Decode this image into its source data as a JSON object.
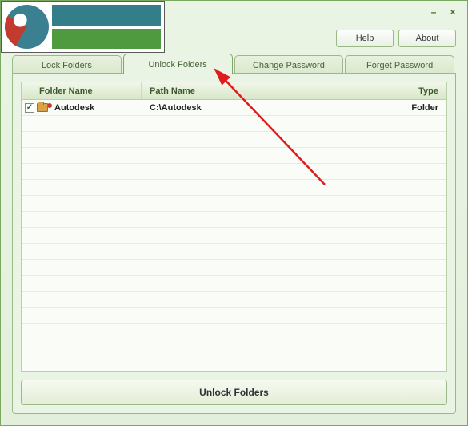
{
  "window": {
    "minimize": "–",
    "close": "×"
  },
  "toolbar": {
    "help": "Help",
    "about": "About"
  },
  "tabs": {
    "lock": "Lock Folders",
    "unlock": "Unlock Folders",
    "change_pw": "Change Password",
    "forget_pw": "Forget Password",
    "active": "unlock"
  },
  "grid": {
    "headers": {
      "name": "Folder Name",
      "path": "Path Name",
      "type": "Type"
    },
    "rows": [
      {
        "checked": true,
        "name": "Autodesk",
        "path": "C:\\Autodesk",
        "type": "Folder"
      }
    ]
  },
  "action": {
    "unlock_btn": "Unlock Folders"
  },
  "colors": {
    "accent_green": "#7fa768",
    "panel_bg": "#eaf4e4",
    "arrow": "#e11b1b"
  }
}
